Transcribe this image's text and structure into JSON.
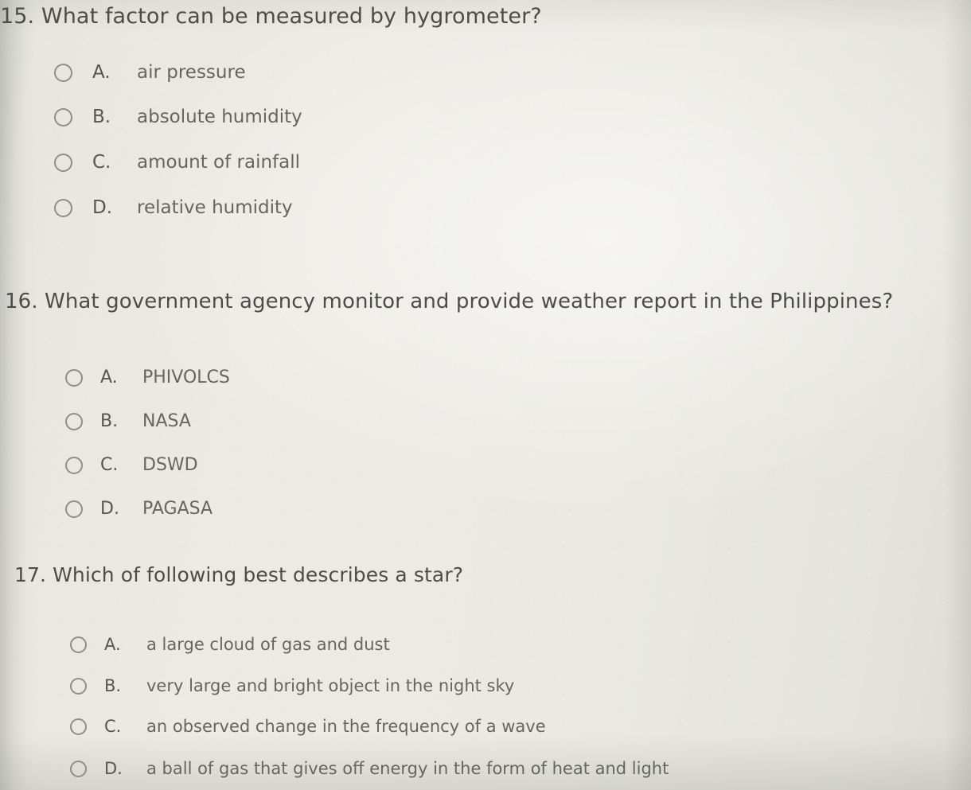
{
  "page": {
    "background_color": "#eae9e3",
    "text_color": "#65665f",
    "heading_color": "#4c4d4a",
    "radio_outline_color": "#8e8f89"
  },
  "questions": [
    {
      "number": "15.",
      "title": "15. What factor can be measured by hygrometer?",
      "options": [
        {
          "letter": "A.",
          "text": "air pressure",
          "selected": false
        },
        {
          "letter": "B.",
          "text": "absolute humidity",
          "selected": false
        },
        {
          "letter": "C.",
          "text": "amount of rainfall",
          "selected": false
        },
        {
          "letter": "D.",
          "text": "relative humidity",
          "selected": false
        }
      ]
    },
    {
      "number": "16.",
      "title": "16. What government agency monitor and provide weather report in the Philippines?",
      "options": [
        {
          "letter": "A.",
          "text": "PHIVOLCS",
          "selected": false
        },
        {
          "letter": "B.",
          "text": "NASA",
          "selected": false
        },
        {
          "letter": "C.",
          "text": "DSWD",
          "selected": false
        },
        {
          "letter": "D.",
          "text": "PAGASA",
          "selected": false
        }
      ]
    },
    {
      "number": "17.",
      "title": "17. Which of following best describes a star?",
      "options": [
        {
          "letter": "A.",
          "text": "a large cloud of gas and dust",
          "selected": false
        },
        {
          "letter": "B.",
          "text": "very large and bright object in the night sky",
          "selected": false
        },
        {
          "letter": "C.",
          "text": "an observed change in the frequency of a wave",
          "selected": false
        },
        {
          "letter": "D.",
          "text": "a ball of gas that gives off energy in the form of heat and light",
          "selected": false
        }
      ]
    }
  ]
}
